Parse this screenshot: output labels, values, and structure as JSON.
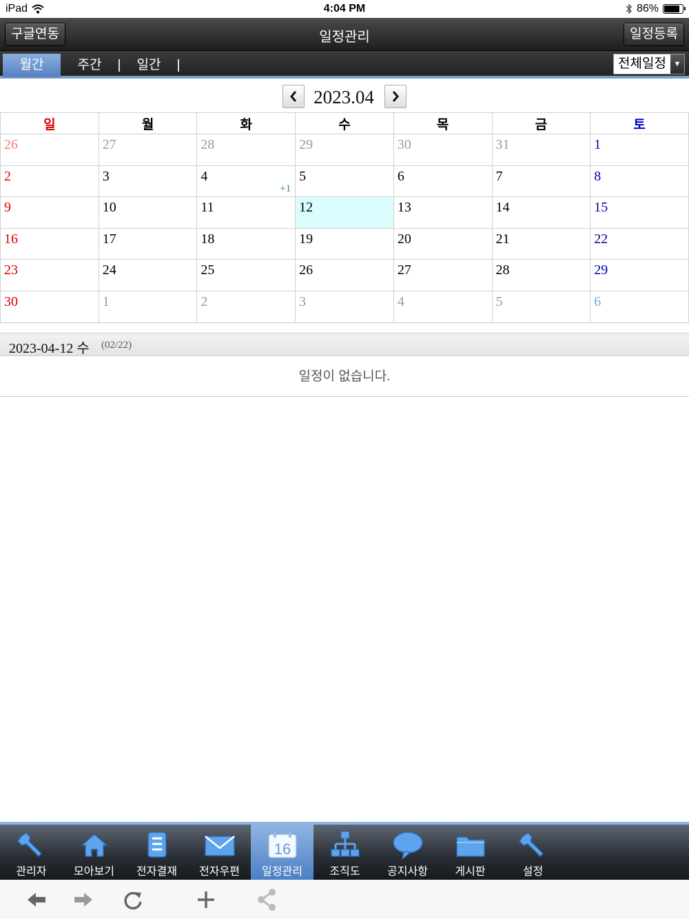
{
  "status_bar": {
    "device": "iPad",
    "time": "4:04 PM",
    "battery": "86%",
    "battery_level": 0.86
  },
  "header": {
    "title": "일정관리",
    "left_button": "구글연동",
    "right_button": "일정등록"
  },
  "view_tabs": [
    {
      "label": "월간",
      "active": true
    },
    {
      "label": "주간",
      "active": false
    },
    {
      "label": "일간",
      "active": false
    }
  ],
  "filter": {
    "selected": "전체일정"
  },
  "month_nav": {
    "label": "2023.04",
    "prev_icon": "chevron-left-icon",
    "next_icon": "chevron-right-icon"
  },
  "calendar": {
    "weekdays": [
      "일",
      "월",
      "화",
      "수",
      "목",
      "금",
      "토"
    ],
    "weeks": [
      [
        {
          "d": "26",
          "other": true
        },
        {
          "d": "27",
          "other": true
        },
        {
          "d": "28",
          "other": true
        },
        {
          "d": "29",
          "other": true
        },
        {
          "d": "30",
          "other": true
        },
        {
          "d": "31",
          "other": true
        },
        {
          "d": "1"
        }
      ],
      [
        {
          "d": "2"
        },
        {
          "d": "3"
        },
        {
          "d": "4",
          "badge": "+1"
        },
        {
          "d": "5"
        },
        {
          "d": "6"
        },
        {
          "d": "7"
        },
        {
          "d": "8"
        }
      ],
      [
        {
          "d": "9"
        },
        {
          "d": "10"
        },
        {
          "d": "11"
        },
        {
          "d": "12",
          "today": true
        },
        {
          "d": "13"
        },
        {
          "d": "14"
        },
        {
          "d": "15"
        }
      ],
      [
        {
          "d": "16"
        },
        {
          "d": "17"
        },
        {
          "d": "18"
        },
        {
          "d": "19"
        },
        {
          "d": "20"
        },
        {
          "d": "21"
        },
        {
          "d": "22"
        }
      ],
      [
        {
          "d": "23"
        },
        {
          "d": "24"
        },
        {
          "d": "25"
        },
        {
          "d": "26"
        },
        {
          "d": "27"
        },
        {
          "d": "28"
        },
        {
          "d": "29"
        }
      ],
      [
        {
          "d": "30"
        },
        {
          "d": "1",
          "other": true
        },
        {
          "d": "2",
          "other": true
        },
        {
          "d": "3",
          "other": true
        },
        {
          "d": "4",
          "other": true
        },
        {
          "d": "5",
          "other": true
        },
        {
          "d": "6",
          "other": true
        }
      ]
    ]
  },
  "selected_day": {
    "date": "2023-04-12 수",
    "sub": "(02/22)",
    "empty_message": "일정이 없습니다."
  },
  "app_menu": [
    {
      "label": "관리자",
      "icon": "wrench-icon",
      "active": false
    },
    {
      "label": "모아보기",
      "icon": "home-icon",
      "active": false
    },
    {
      "label": "전자결재",
      "icon": "document-icon",
      "active": false
    },
    {
      "label": "전자우편",
      "icon": "mail-icon",
      "active": false
    },
    {
      "label": "일정관리",
      "icon": "calendar-icon",
      "icon_text": "16",
      "active": true
    },
    {
      "label": "조직도",
      "icon": "org-chart-icon",
      "active": false
    },
    {
      "label": "공지사항",
      "icon": "speech-bubble-icon",
      "active": false
    },
    {
      "label": "게시판",
      "icon": "folder-icon",
      "active": false
    },
    {
      "label": "설정",
      "icon": "wrench-icon",
      "active": false
    }
  ],
  "browser_toolbar": [
    "back-icon",
    "forward-icon",
    "reload-icon",
    "add-icon",
    "share-icon"
  ],
  "colors": {
    "accent": "#5680c0",
    "sunday": "#dd0000",
    "saturday": "#0000cc",
    "today_bg": "#dcfdfd",
    "badge": "#2a9a2a"
  }
}
